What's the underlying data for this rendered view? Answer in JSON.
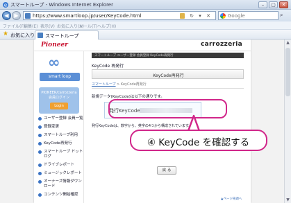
{
  "window": {
    "title": "スマートループ - Windows Internet Explorer"
  },
  "address": {
    "url": "https://www.smartloop.jp/user/KeyCode.html",
    "search_placeholder": "Google"
  },
  "menu": [
    "ファイル(F)",
    "編集(E)",
    "表示(V)",
    "お気に入り(A)",
    "ツール(T)",
    "ヘルプ(H)"
  ],
  "favorites": {
    "label": "お気に入り",
    "tab_title": "スマートループ"
  },
  "site": {
    "brand_left": "Pioneer",
    "brand_right": "carrozzeria",
    "logo_text": "smart loop",
    "login_text": "PIONEER/carrozzeria 会員ログイン",
    "login_button": "Login",
    "side_menu": [
      "ユーザー登録 会員一覧",
      "登録変更",
      "スマートループ利用",
      "KeyCode再発行",
      "スマートループ ドットログ",
      "ドライブレポート",
      "ミュージックレポート",
      "オーナーズ情報ダウンロード",
      "コンテンツ開始確認"
    ],
    "banner_text": "スマートループ ユーザー登録 会員登録 KeyCode再発行",
    "page_heading": "KeyCode 再発行",
    "heading_bar": "KeyCode再発行",
    "breadcrumb_link": "スマートループ",
    "breadcrumb_current": "> KeyCode再発行",
    "intro_text": "新規データ(KeyCode)は以下の通りです。",
    "keycode_label": "発行KeyCode：",
    "note_text": "発行KeyCodeは、数字から、英字の4つから構成されています。",
    "back_button": "戻 る",
    "pagetop": "▲ページ先頭へ"
  },
  "annotation": {
    "callout_text": "④ KeyCode を確認する",
    "color": "#d1268a"
  }
}
